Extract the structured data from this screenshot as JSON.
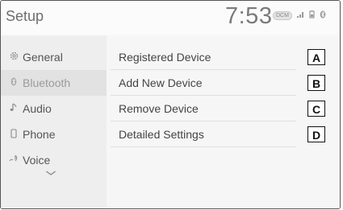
{
  "header": {
    "title": "Setup",
    "clock": "7:53",
    "status": {
      "badge": "DCM",
      "signal_icon": "signal-bars-icon",
      "battery_icon": "battery-icon",
      "bt_icon": "bluetooth-status-icon"
    }
  },
  "sidebar": {
    "items": [
      {
        "label": "General",
        "icon": "gear-icon",
        "glyph": "⚙"
      },
      {
        "label": "Bluetooth",
        "icon": "bluetooth-icon",
        "glyph": "ʙ",
        "selected": true
      },
      {
        "label": "Audio",
        "icon": "music-note-icon",
        "glyph": "♪"
      },
      {
        "label": "Phone",
        "icon": "phone-icon",
        "glyph": "▯"
      },
      {
        "label": "Voice",
        "icon": "voice-icon",
        "glyph": "⁀"
      }
    ],
    "more_icon": "chevron-down-icon"
  },
  "menu": {
    "items": [
      {
        "label": "Registered Device",
        "marker": "A"
      },
      {
        "label": "Add New Device",
        "marker": "B"
      },
      {
        "label": "Remove Device",
        "marker": "C"
      },
      {
        "label": "Detailed Settings",
        "marker": "D"
      }
    ]
  }
}
